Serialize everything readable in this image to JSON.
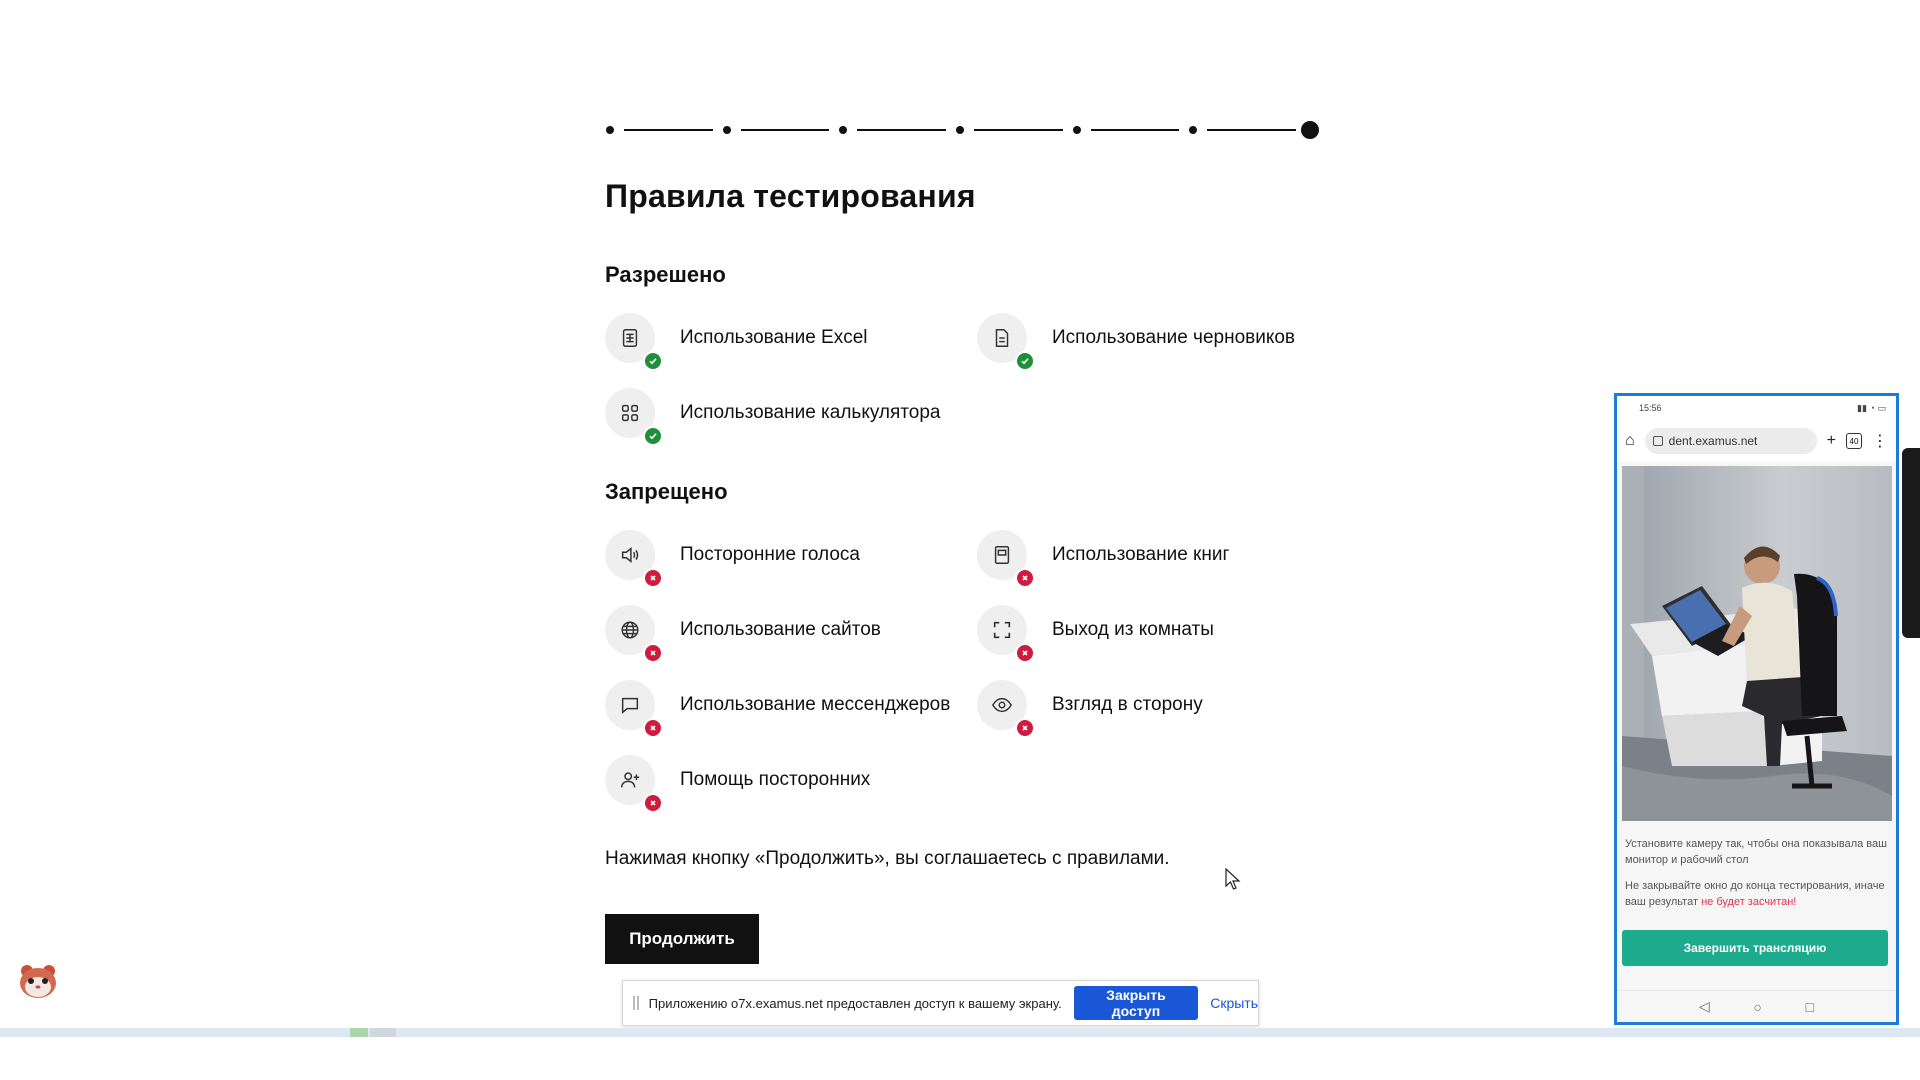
{
  "stepper": {
    "total_steps": 7,
    "current_step": 7
  },
  "page": {
    "title": "Правила тестирования",
    "allowed_title": "Разрешено",
    "forbidden_title": "Запрещено",
    "allowed": [
      {
        "label": "Использование Excel",
        "icon": "spreadsheet-icon"
      },
      {
        "label": "Использование черновиков",
        "icon": "document-icon"
      },
      {
        "label": "Использование калькулятора",
        "icon": "calculator-grid-icon"
      }
    ],
    "forbidden": [
      {
        "label": "Посторонние голоса",
        "icon": "speaker-icon"
      },
      {
        "label": "Использование книг",
        "icon": "book-icon"
      },
      {
        "label": "Использование сайтов",
        "icon": "globe-icon"
      },
      {
        "label": "Выход из комнаты",
        "icon": "fullscreen-frame-icon"
      },
      {
        "label": "Использование мессенджеров",
        "icon": "chat-bubble-icon"
      },
      {
        "label": "Взгляд в сторону",
        "icon": "eye-icon"
      },
      {
        "label": "Помощь посторонних",
        "icon": "add-person-icon"
      }
    ],
    "agree_text": "Нажимая кнопку «Продолжить», вы соглашаетесь с правилами.",
    "continue_label": "Продолжить"
  },
  "share_bar": {
    "message": "Приложению o7x.examus.net предоставлен доступ к вашему экрану.",
    "stop_label": "Закрыть доступ",
    "hide_label": "Скрыть"
  },
  "phone": {
    "time": "15:56",
    "url": "dent.examus.net",
    "tabs_count": "40",
    "instruction": "Установите камеру так, чтобы она показывала ваш монитор и рабочий стол",
    "warning_prefix": "Не закрывайте окно до конца тестирования, иначе ваш результат ",
    "warning_highlight": "не будет засчитан!",
    "end_button": "Завершить трансляцию"
  },
  "colors": {
    "allowed_badge": "#1f8f3a",
    "forbidden_badge": "#cf1c3e",
    "share_button": "#1a57d6",
    "phone_button": "#1dab8d",
    "phone_frame": "#1e7bd8",
    "warning_text": "#e0334f"
  }
}
